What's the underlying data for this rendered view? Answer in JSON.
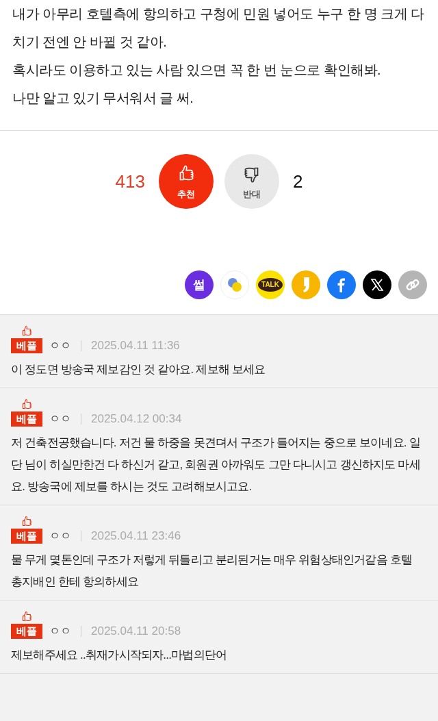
{
  "article": {
    "paragraphs": [
      "내가 아무리 호텔측에 항의하고 구청에 민원 넣어도 누구 한 명 크게 다치기 전엔 안 바뀔 것 같아.",
      "혹시라도 이용하고 있는 사람 있으면 꼭 한 번 눈으로 확인해봐.",
      "나만 알고 있기 무서워서 글 써."
    ]
  },
  "votes": {
    "up_count": "413",
    "up_label": "추천",
    "down_label": "반대",
    "down_count": "2"
  },
  "share": [
    {
      "kind": "ssul",
      "label": "썰"
    },
    {
      "kind": "bubbles"
    },
    {
      "kind": "kakaotalk",
      "label": "TALK"
    },
    {
      "kind": "comma"
    },
    {
      "kind": "facebook"
    },
    {
      "kind": "x"
    },
    {
      "kind": "link"
    }
  ],
  "comments": [
    {
      "badge": "베플",
      "author": "ㅇㅇ",
      "date": "2025.04.11 11:36",
      "text": "이 정도면 방송국 제보감인 것 같아요. 제보해 보세요"
    },
    {
      "badge": "베플",
      "author": "ㅇㅇ",
      "date": "2025.04.12 00:34",
      "text": "저 건축전공했습니다. 저건 물 하중을 못견뎌서 구조가 틀어지는 중으로 보이네요. 일단 님이 히실만한건 다 하신거 같고, 회원권 아까워도 그만 다니시고 갱신하지도 마세요. 방송국에 제보를 하시는 것도 고려해보시고요."
    },
    {
      "badge": "베플",
      "author": "ㅇㅇ",
      "date": "2025.04.11 23:46",
      "text": "물 무게 몇톤인데 구조가 저렇게 뒤틀리고 분리된거는 매우 위험상태인거같음 호텔 총지배인 한테 항의하세요"
    },
    {
      "badge": "베플",
      "author": "ㅇㅇ",
      "date": "2025.04.11 20:58",
      "text": "제보해주세요 ..취재가시작되자...마법의단어"
    }
  ]
}
